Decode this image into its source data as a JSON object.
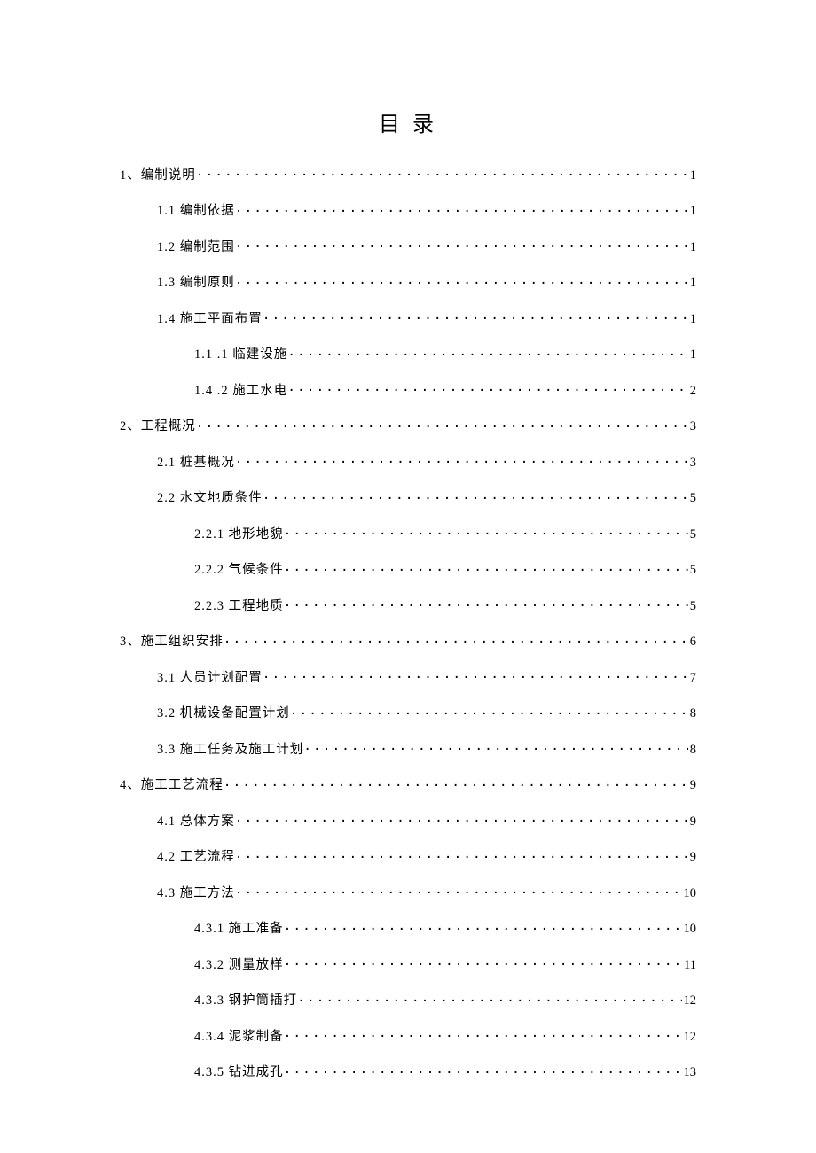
{
  "title": "目 录",
  "toc": [
    {
      "level": 0,
      "label": "1、编制说明",
      "page": "1"
    },
    {
      "level": 1,
      "label": "1.1  编制依据",
      "page": "1"
    },
    {
      "level": 1,
      "label": "1.2  编制范围",
      "page": "1"
    },
    {
      "level": 1,
      "label": "1.3  编制原则",
      "page": "1"
    },
    {
      "level": 1,
      "label": "1.4 施工平面布置",
      "page": "1"
    },
    {
      "level": 2,
      "label": "1.1 .1 临建设施 ",
      "page": "1"
    },
    {
      "level": 2,
      "label": "1.4 .2 施工水电 ",
      "page": "2"
    },
    {
      "level": 0,
      "label": "2、工程概况",
      "page": "3"
    },
    {
      "level": 1,
      "label": "2.1 桩基概况 ",
      "page": "3"
    },
    {
      "level": 1,
      "label": "2.2 水文地质条件 ",
      "page": "5"
    },
    {
      "level": 2,
      "label": "2.2.1 地形地貌",
      "page": "5"
    },
    {
      "level": 2,
      "label": "2.2.2 气候条件",
      "page": "5"
    },
    {
      "level": 2,
      "label": "2.2.3 工程地质",
      "page": "5"
    },
    {
      "level": 0,
      "label": "3、施工组织安排",
      "page": "6"
    },
    {
      "level": 1,
      "label": "3.1 人员计划配置 ",
      "page": "7"
    },
    {
      "level": 1,
      "label": "3.2 机械设备配置计划 ",
      "page": " 8"
    },
    {
      "level": 1,
      "label": "3.3 施工任务及施工计划 ",
      "page": " 8"
    },
    {
      "level": 0,
      "label": "4、施工工艺流程",
      "page": "9"
    },
    {
      "level": 1,
      "label": "4.1 总体方案 ",
      "page": " 9"
    },
    {
      "level": 1,
      "label": "4.2 工艺流程 ",
      "page": "9"
    },
    {
      "level": 1,
      "label": "4.3 施工方法 ",
      "page": " 10"
    },
    {
      "level": 2,
      "label": "4.3.1 施工准备",
      "page": " 10"
    },
    {
      "level": 2,
      "label": "4.3.2 测量放样",
      "page": " 11"
    },
    {
      "level": 2,
      "label": "4.3.3 钢护筒插打",
      "page": " 12"
    },
    {
      "level": 2,
      "label": "4.3.4 泥浆制备",
      "page": " 12"
    },
    {
      "level": 2,
      "label": "4.3.5 钻进成孔",
      "page": " 13"
    }
  ]
}
